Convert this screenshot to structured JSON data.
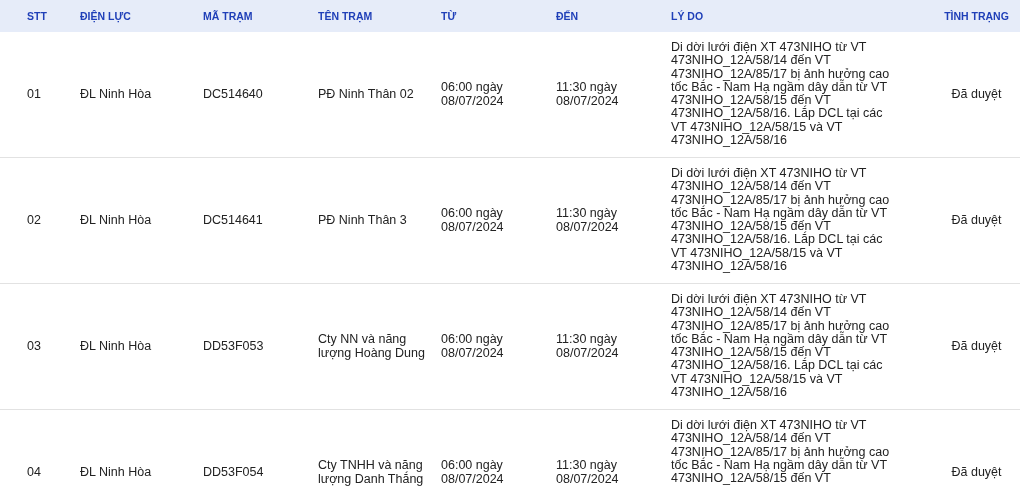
{
  "table": {
    "columns": [
      "STT",
      "ĐIỆN LỰC",
      "MÃ TRẠM",
      "TÊN TRẠM",
      "TỪ",
      "ĐẾN",
      "LÝ DO",
      "TÌNH TRẠNG"
    ],
    "rows": [
      {
        "stt": "01",
        "dien_luc": "ĐL Ninh Hòa",
        "ma_tram": "DC514640",
        "ten_tram": "PĐ Ninh Thân 02",
        "tu": "06:00 ngày 08/07/2024",
        "den": "11:30 ngày 08/07/2024",
        "ly_do": "Di dời lưới điện XT 473NIHO từ VT 473NIHO_12A/58/14 đến VT 473NIHO_12A/85/17 bị ảnh hưởng cao tốc Bắc - Nam Hạ ngầm dây dẫn từ VT 473NIHO_12A/58/15 đến VT 473NIHO_12A/58/16. Lắp DCL tại các VT 473NIHO_12A/58/15 và VT 473NIHO_12A/58/16",
        "tinh_trang": "Đã duyệt"
      },
      {
        "stt": "02",
        "dien_luc": "ĐL Ninh Hòa",
        "ma_tram": "DC514641",
        "ten_tram": "PĐ Ninh Thân 3",
        "tu": "06:00 ngày 08/07/2024",
        "den": "11:30 ngày 08/07/2024",
        "ly_do": "Di dời lưới điện XT 473NIHO từ VT 473NIHO_12A/58/14 đến VT 473NIHO_12A/85/17 bị ảnh hưởng cao tốc Bắc - Nam Hạ ngầm dây dẫn từ VT 473NIHO_12A/58/15 đến VT 473NIHO_12A/58/16. Lắp DCL tại các VT 473NIHO_12A/58/15 và VT 473NIHO_12A/58/16",
        "tinh_trang": "Đã duyệt"
      },
      {
        "stt": "03",
        "dien_luc": "ĐL Ninh Hòa",
        "ma_tram": "DD53F053",
        "ten_tram": "Cty NN và năng lượng Hoàng Dung",
        "tu": "06:00 ngày 08/07/2024",
        "den": "11:30 ngày 08/07/2024",
        "ly_do": "Di dời lưới điện XT 473NIHO từ VT 473NIHO_12A/58/14 đến VT 473NIHO_12A/85/17 bị ảnh hưởng cao tốc Bắc - Nam Hạ ngầm dây dẫn từ VT 473NIHO_12A/58/15 đến VT 473NIHO_12A/58/16. Lắp DCL tại các VT 473NIHO_12A/58/15 và VT 473NIHO_12A/58/16",
        "tinh_trang": "Đã duyệt"
      },
      {
        "stt": "04",
        "dien_luc": "ĐL Ninh Hòa",
        "ma_tram": "DD53F054",
        "ten_tram": "Cty TNHH và năng lượng Danh Thắng",
        "tu": "06:00 ngày 08/07/2024",
        "den": "11:30 ngày 08/07/2024",
        "ly_do": "Di dời lưới điện XT 473NIHO từ VT 473NIHO_12A/58/14 đến VT 473NIHO_12A/85/17 bị ảnh hưởng cao tốc Bắc - Nam Hạ ngầm dây dẫn từ VT 473NIHO_12A/58/15 đến VT",
        "tinh_trang": "Đã duyệt"
      }
    ]
  }
}
